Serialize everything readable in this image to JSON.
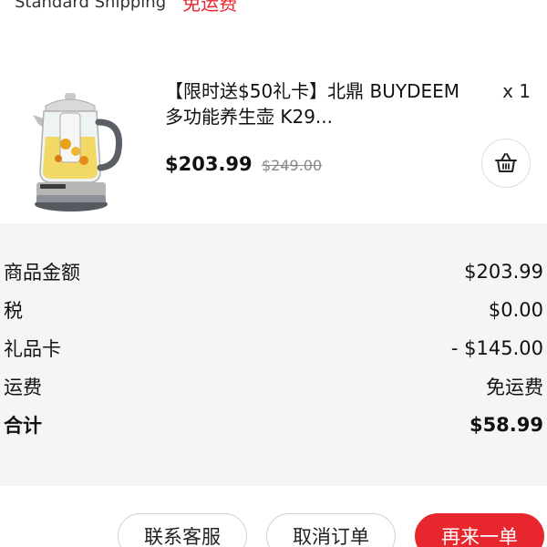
{
  "shipping": {
    "method": "Standard Shipping",
    "free_label": "免运费"
  },
  "product": {
    "title": "【限时送$50礼卡】北鼎 BUYDEEM 多功能养生壶 K29...",
    "quantity": "x 1",
    "price": "$203.99",
    "original_price": "$249.00",
    "cart_icon": "basket-icon",
    "image_icon": "kettle-icon"
  },
  "summary": {
    "rows": [
      {
        "label": "商品金额",
        "value": "$203.99"
      },
      {
        "label": "税",
        "value": "$0.00"
      },
      {
        "label": "礼品卡",
        "value": "- $145.00"
      },
      {
        "label": "运费",
        "value": "免运费"
      },
      {
        "label": "合计",
        "value": "$58.99"
      }
    ]
  },
  "actions": {
    "contact": "联系客服",
    "cancel": "取消订单",
    "reorder": "再来一单"
  },
  "colors": {
    "accent": "#e8262e",
    "summary_bg": "#f5f5f5"
  }
}
